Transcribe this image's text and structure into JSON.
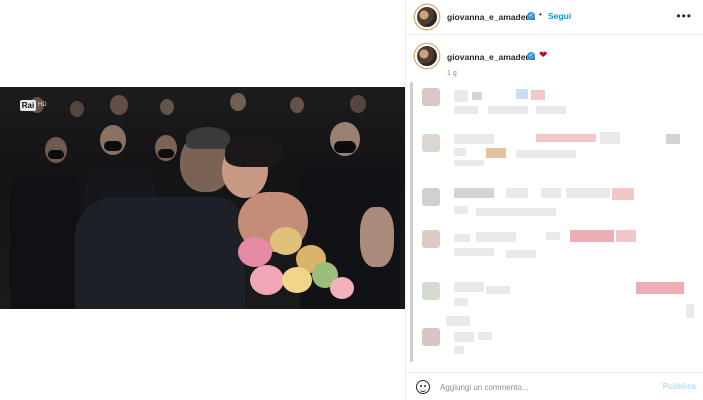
{
  "post": {
    "username": "giovanna_e_amadeus",
    "follow_label": "Segui",
    "separator": "•",
    "more_icon": "more-horizontal-icon",
    "caption_emoji": "❤",
    "time_ago": "1 g"
  },
  "video": {
    "channel_logo": "Rai",
    "logo_badge": "HD"
  },
  "comment_box": {
    "placeholder": "Aggiungi un commento...",
    "publish_label": "Pubblica",
    "emoji_icon": "smiley-icon"
  },
  "colors": {
    "link_blue": "#0095f6",
    "publish_disabled": "#b2dffc",
    "verified_blue": "#3897f0",
    "heart_red": "#c0102e"
  }
}
